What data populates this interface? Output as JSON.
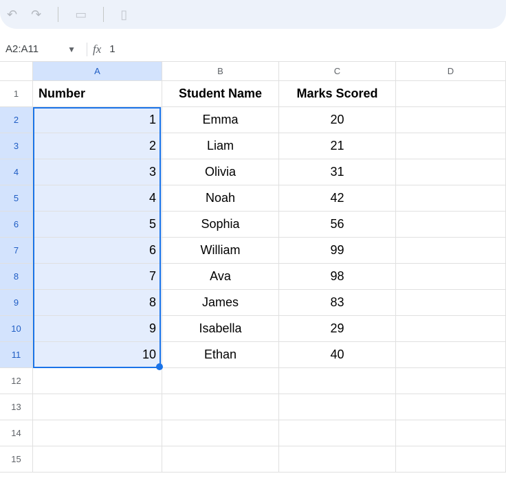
{
  "nameBox": {
    "value": "A2:A11"
  },
  "formulaBar": {
    "fxLabel": "fx",
    "value": "1"
  },
  "columns": [
    {
      "label": "A",
      "selected": true
    },
    {
      "label": "B",
      "selected": false
    },
    {
      "label": "C",
      "selected": false
    },
    {
      "label": "D",
      "selected": false
    }
  ],
  "headerRow": {
    "rowNum": "1",
    "a": "Number",
    "b": "Student Name",
    "c": "Marks Scored"
  },
  "dataRows": [
    {
      "rowNum": "2",
      "a": "1",
      "b": "Emma",
      "c": "20",
      "selected": true
    },
    {
      "rowNum": "3",
      "a": "2",
      "b": "Liam",
      "c": "21",
      "selected": true
    },
    {
      "rowNum": "4",
      "a": "3",
      "b": "Olivia",
      "c": "31",
      "selected": true
    },
    {
      "rowNum": "5",
      "a": "4",
      "b": "Noah",
      "c": "42",
      "selected": true
    },
    {
      "rowNum": "6",
      "a": "5",
      "b": "Sophia",
      "c": "56",
      "selected": true
    },
    {
      "rowNum": "7",
      "a": "6",
      "b": "William",
      "c": "99",
      "selected": true
    },
    {
      "rowNum": "8",
      "a": "7",
      "b": "Ava",
      "c": "98",
      "selected": true
    },
    {
      "rowNum": "9",
      "a": "8",
      "b": "James",
      "c": "83",
      "selected": true
    },
    {
      "rowNum": "10",
      "a": "9",
      "b": "Isabella",
      "c": "29",
      "selected": true
    },
    {
      "rowNum": "11",
      "a": "10",
      "b": "Ethan",
      "c": "40",
      "selected": true
    }
  ],
  "emptyRows": [
    {
      "rowNum": "12"
    },
    {
      "rowNum": "13"
    },
    {
      "rowNum": "14"
    },
    {
      "rowNum": "15"
    }
  ]
}
